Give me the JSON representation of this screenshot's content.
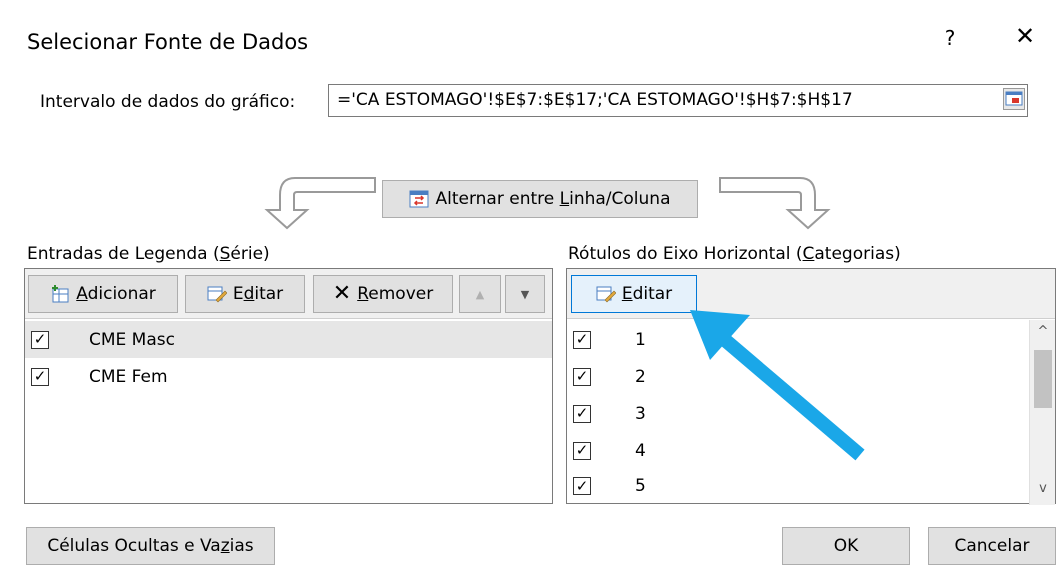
{
  "dialog": {
    "title": "Selecionar Fonte de Dados",
    "help": "?",
    "close": "✕"
  },
  "range": {
    "label": "Intervalo de dados do gráfico:",
    "value": "='CA ESTOMAGO'!$E$7:$E$17;'CA ESTOMAGO'!$H$7:$H$17"
  },
  "switch_label": "Alternar entre Linha/Coluna",
  "legend": {
    "title": "Entradas de Legenda (Série)",
    "add": "Adicionar",
    "edit": "Editar",
    "remove": "Remover",
    "move_up": "▲",
    "move_down": "▼",
    "items": [
      {
        "label": "CME Masc",
        "checked": true,
        "selected": true
      },
      {
        "label": "CME Fem",
        "checked": true,
        "selected": false
      }
    ]
  },
  "axis": {
    "title": "Rótulos do Eixo Horizontal (Categorias)",
    "edit": "Editar",
    "items": [
      "1",
      "2",
      "3",
      "4",
      "5"
    ],
    "scroll_up": "^",
    "scroll_down": "v"
  },
  "footer": {
    "hidden_cells": "Células Ocultas e Vazias",
    "ok": "OK",
    "cancel": "Cancelar"
  },
  "colors": {
    "annotation_arrow": "#1aa7e8",
    "button_bg": "#e1e1e1"
  }
}
